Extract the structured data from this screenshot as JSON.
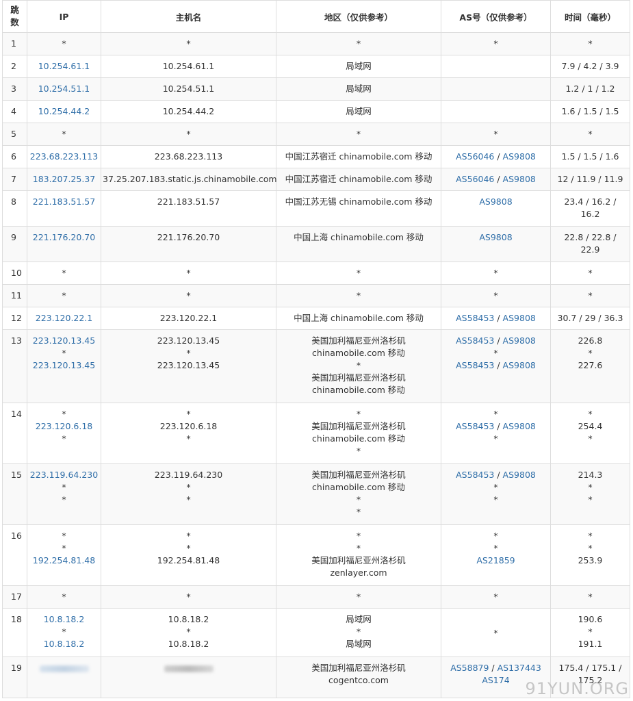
{
  "headers": [
    "跳\n数",
    "IP",
    "主机名",
    "地区（仅供参考）",
    "AS号（仅供参考）",
    "时间（毫秒）"
  ],
  "rows": [
    {
      "hop": "1",
      "ip": [
        "*"
      ],
      "host": [
        "*"
      ],
      "region": [
        "*"
      ],
      "asn": [
        [
          "*"
        ]
      ],
      "time": [
        "*"
      ]
    },
    {
      "hop": "2",
      "ip": [
        "10.254.61.1"
      ],
      "host": [
        "10.254.61.1"
      ],
      "region": [
        "局域网"
      ],
      "asn": [
        []
      ],
      "time": [
        "7.9 / 4.2 / 3.9"
      ]
    },
    {
      "hop": "3",
      "ip": [
        "10.254.51.1"
      ],
      "host": [
        "10.254.51.1"
      ],
      "region": [
        "局域网"
      ],
      "asn": [
        []
      ],
      "time": [
        "1.2 / 1 / 1.2"
      ]
    },
    {
      "hop": "4",
      "ip": [
        "10.254.44.2"
      ],
      "host": [
        "10.254.44.2"
      ],
      "region": [
        "局域网"
      ],
      "asn": [
        []
      ],
      "time": [
        "1.6 / 1.5 / 1.5"
      ]
    },
    {
      "hop": "5",
      "ip": [
        "*"
      ],
      "host": [
        "*"
      ],
      "region": [
        "*"
      ],
      "asn": [
        [
          "*"
        ]
      ],
      "time": [
        "*"
      ]
    },
    {
      "hop": "6",
      "ip": [
        "223.68.223.113"
      ],
      "host": [
        "223.68.223.113"
      ],
      "region": [
        "中国江苏宿迁 chinamobile.com 移动"
      ],
      "asn": [
        [
          "AS56046",
          "AS9808"
        ]
      ],
      "time": [
        "1.5 / 1.5 / 1.6"
      ]
    },
    {
      "hop": "7",
      "ip": [
        "183.207.25.37"
      ],
      "host": [
        "37.25.207.183.static.js.chinamobile.com"
      ],
      "region": [
        "中国江苏宿迁 chinamobile.com 移动"
      ],
      "asn": [
        [
          "AS56046",
          "AS9808"
        ]
      ],
      "time": [
        "12 / 11.9 / 11.9"
      ]
    },
    {
      "hop": "8",
      "ip": [
        "221.183.51.57"
      ],
      "host": [
        "221.183.51.57"
      ],
      "region": [
        "中国江苏无锡 chinamobile.com 移动"
      ],
      "asn": [
        [
          "AS9808"
        ]
      ],
      "time": [
        "23.4 / 16.2 /",
        "16.2"
      ]
    },
    {
      "hop": "9",
      "ip": [
        "221.176.20.70"
      ],
      "host": [
        "221.176.20.70"
      ],
      "region": [
        "中国上海 chinamobile.com 移动"
      ],
      "asn": [
        [
          "AS9808"
        ]
      ],
      "time": [
        "22.8 / 22.8 /",
        "22.9"
      ]
    },
    {
      "hop": "10",
      "ip": [
        "*"
      ],
      "host": [
        "*"
      ],
      "region": [
        "*"
      ],
      "asn": [
        [
          "*"
        ]
      ],
      "time": [
        "*"
      ]
    },
    {
      "hop": "11",
      "ip": [
        "*"
      ],
      "host": [
        "*"
      ],
      "region": [
        "*"
      ],
      "asn": [
        [
          "*"
        ]
      ],
      "time": [
        "*"
      ]
    },
    {
      "hop": "12",
      "ip": [
        "223.120.22.1"
      ],
      "host": [
        "223.120.22.1"
      ],
      "region": [
        "中国上海 chinamobile.com 移动"
      ],
      "asn": [
        [
          "AS58453",
          "AS9808"
        ]
      ],
      "time": [
        "30.7 / 29 / 36.3"
      ]
    },
    {
      "hop": "13",
      "ip": [
        "223.120.13.45",
        "*",
        "223.120.13.45"
      ],
      "host": [
        "223.120.13.45",
        "*",
        "223.120.13.45"
      ],
      "region": [
        "美国加利福尼亚州洛杉矶",
        "chinamobile.com 移动",
        "*",
        "美国加利福尼亚州洛杉矶",
        "chinamobile.com 移动"
      ],
      "asn": [
        [
          "AS58453",
          "AS9808"
        ],
        [
          "*"
        ],
        [
          "AS58453",
          "AS9808"
        ]
      ],
      "time": [
        "226.8",
        "*",
        "227.6"
      ]
    },
    {
      "hop": "14",
      "ip": [
        "*",
        "223.120.6.18",
        "*"
      ],
      "host": [
        "*",
        "223.120.6.18",
        "*"
      ],
      "region": [
        "*",
        "美国加利福尼亚州洛杉矶",
        "chinamobile.com 移动",
        "*"
      ],
      "asn": [
        [
          "*"
        ],
        [
          "AS58453",
          "AS9808"
        ],
        [
          "*"
        ]
      ],
      "time": [
        "*",
        "254.4",
        "*"
      ]
    },
    {
      "hop": "15",
      "ip": [
        "223.119.64.230",
        "*",
        "*"
      ],
      "host": [
        "223.119.64.230",
        "*",
        "*"
      ],
      "region": [
        "美国加利福尼亚州洛杉矶",
        "chinamobile.com 移动",
        "*",
        "*"
      ],
      "asn": [
        [
          "AS58453",
          "AS9808"
        ],
        [
          "*"
        ],
        [
          "*"
        ]
      ],
      "time": [
        "214.3",
        "*",
        "*"
      ]
    },
    {
      "hop": "16",
      "ip": [
        "*",
        "*",
        "192.254.81.48"
      ],
      "host": [
        "*",
        "*",
        "192.254.81.48"
      ],
      "region": [
        "*",
        "*",
        "美国加利福尼亚州洛杉矶",
        "zenlayer.com"
      ],
      "asn": [
        [
          "*"
        ],
        [
          "*"
        ],
        [
          "AS21859"
        ]
      ],
      "time": [
        "*",
        "*",
        "253.9"
      ]
    },
    {
      "hop": "17",
      "ip": [
        "*"
      ],
      "host": [
        "*"
      ],
      "region": [
        "*"
      ],
      "asn": [
        [
          "*"
        ]
      ],
      "time": [
        "*"
      ]
    },
    {
      "hop": "18",
      "ip": [
        "10.8.18.2",
        "*",
        "10.8.18.2"
      ],
      "host": [
        "10.8.18.2",
        "*",
        "10.8.18.2"
      ],
      "region": [
        "局域网",
        "*",
        "局域网"
      ],
      "asn": [
        [],
        [
          "*"
        ],
        []
      ],
      "time": [
        "190.6",
        "*",
        "191.1"
      ]
    },
    {
      "hop": "19",
      "ip": [],
      "host": [],
      "region": [
        "美国加利福尼亚州洛杉矶",
        "cogentco.com"
      ],
      "asn": [
        [
          "AS58879",
          "AS137443"
        ],
        [
          "AS174"
        ]
      ],
      "time": [
        "175.4 / 175.1 /",
        "175.2"
      ]
    }
  ],
  "watermark": "91YUN.ORG",
  "colors": {
    "link": "#2f6ea8",
    "border": "#dddddd",
    "stripe": "#f9f9f9"
  }
}
